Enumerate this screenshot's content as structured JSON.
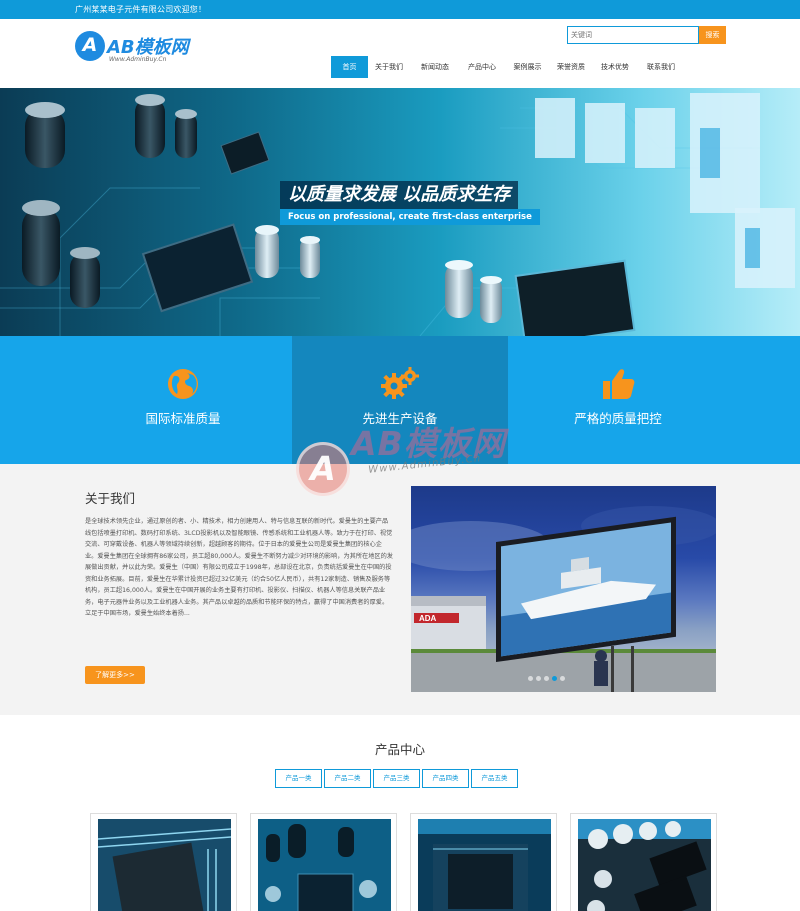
{
  "topbar": {
    "welcome": "广州某某电子元件有限公司欢迎您！"
  },
  "logo": {
    "name": "AB模板网",
    "site": "Www.AdminBuy.Cn",
    "mark": "A"
  },
  "search": {
    "placeholder": "关键词",
    "button": "搜索"
  },
  "nav": [
    {
      "label": "首页",
      "active": true
    },
    {
      "label": "关于我们",
      "active": false
    },
    {
      "label": "新闻动态",
      "active": false
    },
    {
      "label": "产品中心",
      "active": false
    },
    {
      "label": "案例展示",
      "active": false
    },
    {
      "label": "荣誉资质",
      "active": false
    },
    {
      "label": "技术优势",
      "active": false
    },
    {
      "label": "联系我们",
      "active": false
    }
  ],
  "banner": {
    "slogan_cn": "以质量求发展  以品质求生存",
    "slogan_en": "Focus on professional, create first-class enterprise"
  },
  "features": [
    {
      "icon": "globe-icon",
      "label": "国际标准质量"
    },
    {
      "icon": "gears-icon",
      "label": "先进生产设备"
    },
    {
      "icon": "thumbs-up-icon",
      "label": "严格的质量把控"
    }
  ],
  "watermark": {
    "name": "AB模板网",
    "site": "Www.AdminBuy.Cn",
    "mark": "A"
  },
  "about": {
    "title": "关于我们",
    "body": "是全球技术领先企业，通过原创的者、小、精技术，相力创建用人、特与信息互联的新时代。爱曼生的主要产品线包括喷墨打印机、数码打印系统、3LCD投影机以及智能眼镜、传感系统和工业机器人等。致力于在打印、视觉交流、可穿戴设备、机器人等领域持续创新，超越顾客的期待。位于日本的爱曼生公司是爱曼生集团的核心企业。爱曼生集团在全球拥有86家公司，员工超80,000人。爱曼生不断努力减少对环境的影响，为其所在地区的发展做出贡献，并以此为荣。爱曼生（中国）有限公司成立于1998年，总部设在北京，负责统括爱曼生在中国的投资和业务拓展。目前，爱曼生在华累计投资已超过32亿美元（约合50亿人民币），共有12家制造、销售及服务等机构，员工超16,000人。爱曼生在中国开展的业务主要有打印机、投影仪、扫描仪、机器人等信息关联产品业务，电子元器件业务以及工业机器人业务。其产品以卓越的品质和节能环保的特点，赢得了中国消费者的厚爱。立足于中国市场，爱曼生始终本着扬...",
    "more": "了解更多>>",
    "slider_dots": 5,
    "slider_active": 3
  },
  "products": {
    "title": "产品中心",
    "tabs": [
      "产品一类",
      "产品二类",
      "产品三类",
      "产品四类",
      "产品五类"
    ]
  },
  "colors": {
    "primary": "#0f9ad9",
    "accent": "#f7941d",
    "feature_bg": "#16a5ea",
    "feature_mid": "#1487be"
  }
}
